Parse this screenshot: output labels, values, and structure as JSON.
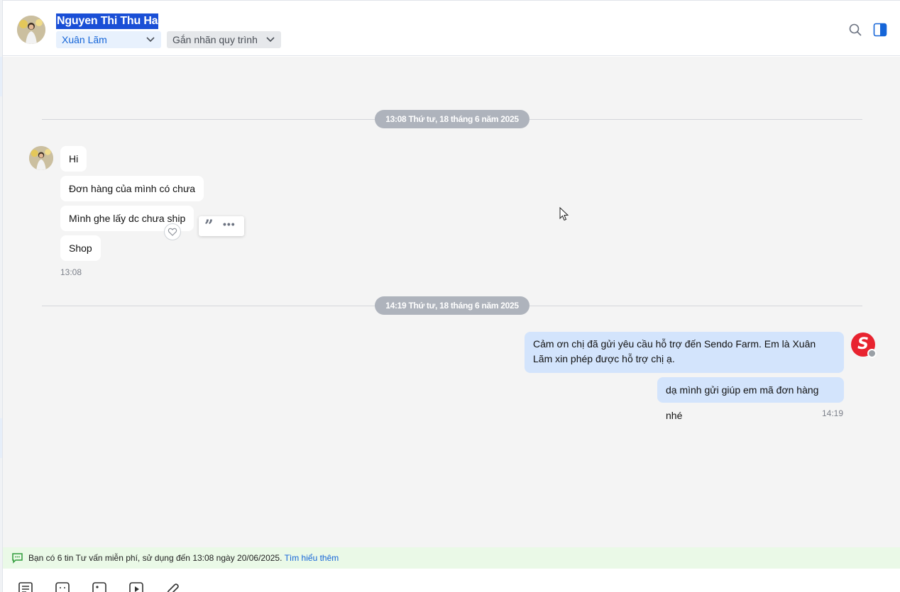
{
  "header": {
    "contact_name": "Nguyen Thi Thu Ha",
    "assignee": "Xuân Lãm",
    "tag_placeholder": "Gắn nhãn quy trình"
  },
  "conversation": {
    "sections": [
      {
        "date_label": "13:08 Thứ tư, 18 tháng 6 năm 2025",
        "incoming": [
          "Hi",
          "Đơn hàng của mình có chưa",
          "Mình ghe lấy dc chưa ship",
          "Shop"
        ],
        "time": "13:08"
      },
      {
        "date_label": "14:19 Thứ tư, 18 tháng 6 năm 2025",
        "outgoing": [
          "Cảm ơn chị đã gửi yêu cầu hỗ trợ đến Sendo Farm. Em là Xuân Lãm xin phép được hỗ trợ chị ạ.",
          "dạ mình gửi giúp em mã đơn hàng nhé"
        ],
        "time": "14:19"
      }
    ]
  },
  "notice": {
    "text": "Bạn có 6 tin Tư vấn miễn phí, sử dụng đến 13:08 ngày 20/06/2025.",
    "link": "Tìm hiểu thêm"
  },
  "icons": {
    "header": [
      "search-icon",
      "panel-toggle-icon"
    ],
    "message_tools": [
      "quote-icon",
      "more-icon",
      "heart-icon"
    ],
    "toolbar": [
      "text-format-icon",
      "sticker-icon",
      "image-icon",
      "video-icon",
      "attachment-icon"
    ]
  },
  "colors": {
    "accent": "#1565d8",
    "outgoing_bubble": "#d3e4fc",
    "shop_brand": "#e8232f",
    "notice_bg": "#eaf9e7"
  }
}
